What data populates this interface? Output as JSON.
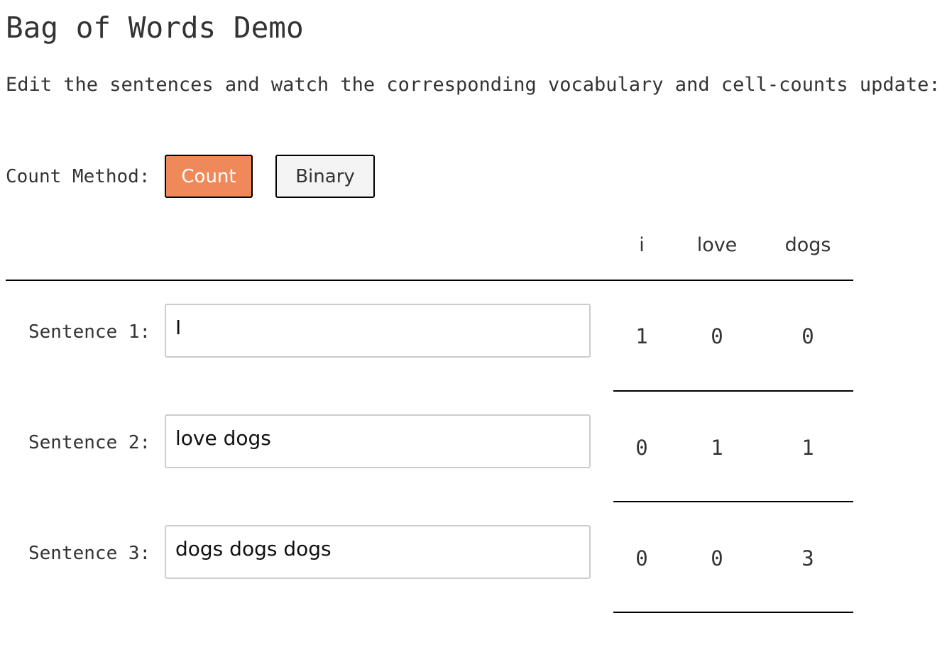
{
  "page": {
    "title": "Bag of Words Demo",
    "subtitle": "Edit the sentences and watch the corresponding vocabulary and cell-counts update:"
  },
  "count_method": {
    "label": "Count Method:",
    "options": [
      "Count",
      "Binary"
    ],
    "selected": "Count",
    "active_color": "#f0895a",
    "inactive_color": "#f4f4f4"
  },
  "vocabulary": [
    "i",
    "love",
    "dogs"
  ],
  "sentences": [
    {
      "label": "Sentence 1:",
      "value": "I",
      "counts": [
        "1",
        "0",
        "0"
      ]
    },
    {
      "label": "Sentence 2:",
      "value": "love dogs",
      "counts": [
        "0",
        "1",
        "1"
      ]
    },
    {
      "label": "Sentence 3:",
      "value": "dogs dogs dogs",
      "counts": [
        "0",
        "0",
        "3"
      ]
    }
  ]
}
